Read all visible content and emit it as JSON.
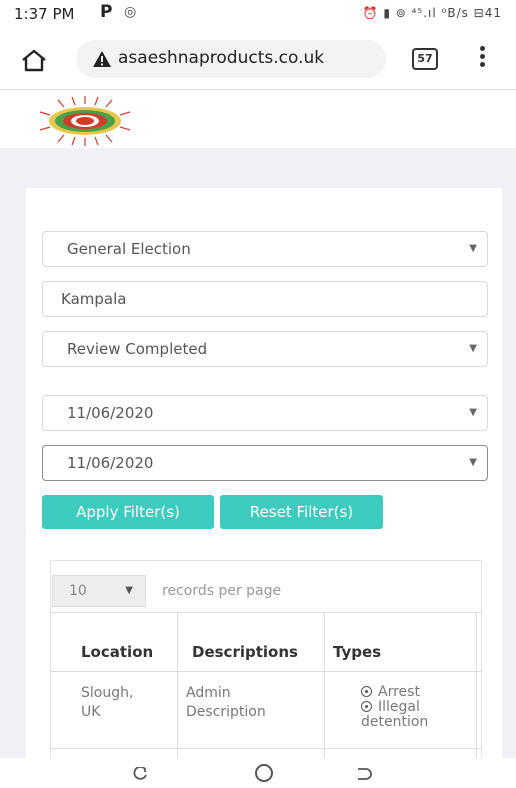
{
  "status_bar": {
    "time": "1:37 PM",
    "p_icon": "P",
    "right_icons": "⏰ ▮ ⊚ ⁴⁵.ıl ⁰B/s ⊟41"
  },
  "browser": {
    "url": "asaeshnaproducts.co.uk",
    "tab_count": "57"
  },
  "filters": {
    "election_type": "General Election",
    "district": "Kampala",
    "status": "Review Completed",
    "date_from": "11/06/2020",
    "date_to": "11/06/2020",
    "apply_label": "Apply Filter(s)",
    "reset_label": "Reset Filter(s)"
  },
  "table": {
    "per_page_value": "10",
    "per_page_label": "records per page",
    "headers": [
      "Location",
      "Descriptions",
      "Types"
    ],
    "rows": [
      {
        "location_line1": "Slough,",
        "location_line2": "UK",
        "description_line1": "Admin",
        "description_line2": "Description",
        "types": [
          "Arrest",
          "Illegal detention"
        ]
      }
    ]
  },
  "colors": {
    "accent": "#3ecbbf",
    "page_bg": "#f0f1f5"
  },
  "icons": [
    "home-icon",
    "warning-icon",
    "tabs-icon",
    "more-menu-icon",
    "logo",
    "recent-apps-icon",
    "nav-home-icon",
    "back-icon"
  ]
}
